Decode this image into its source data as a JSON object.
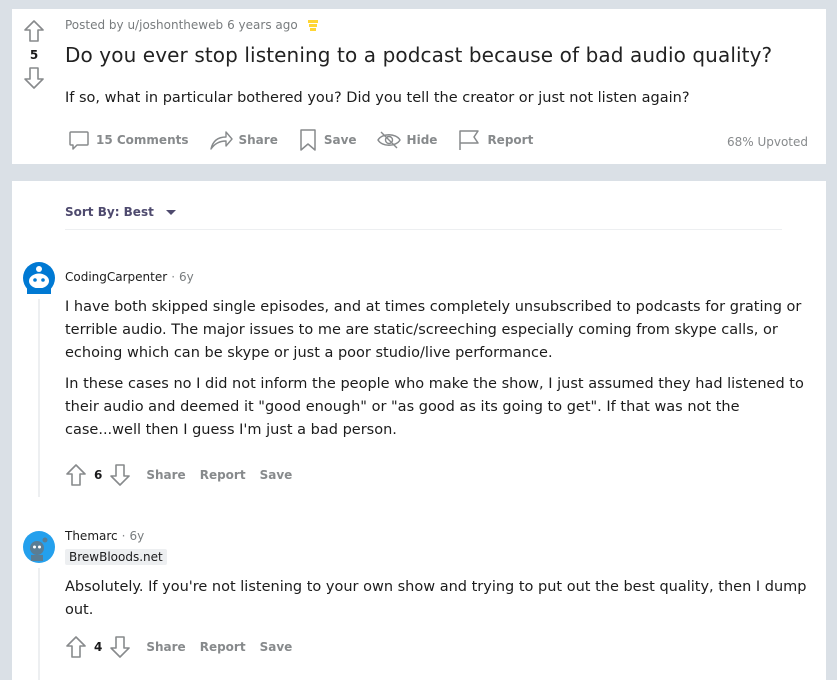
{
  "post": {
    "score": "5",
    "posted_by": "Posted by u/joshontheweb",
    "age": "6 years ago",
    "title": "Do you ever stop listening to a podcast because of bad audio quality?",
    "body": "If so, what in particular bothered you? Did you tell the creator or just not listen again?",
    "actions": {
      "comments": "15 Comments",
      "share": "Share",
      "save": "Save",
      "hide": "Hide",
      "report": "Report"
    },
    "upvoted": "68% Upvoted"
  },
  "sort": {
    "label": "Sort By: Best"
  },
  "comments": [
    {
      "author": "CodingCarpenter",
      "dot": "·",
      "age": "6y",
      "paragraphs": [
        "I have both skipped single episodes, and at times completely unsubscribed to podcasts for grating or terrible audio. The major issues to me are static/screeching especially coming from skype calls, or echoing which can be skype or just a poor studio/live performance.",
        "In these cases no I did not inform the people who make the show, I just assumed they had listened to their audio and deemed it \"good enough\" or \"as good as its going to get\". If that was not the case...well then I guess I'm just a bad person."
      ],
      "score": "6",
      "share": "Share",
      "report": "Report",
      "save": "Save"
    },
    {
      "author": "Themarc",
      "dot": "·",
      "age": "6y",
      "flair": "BrewBloods.net",
      "paragraphs": [
        "Absolutely. If you're not listening to your own show and trying to put out the best quality, then I dump out."
      ],
      "score": "4",
      "share": "Share",
      "report": "Report",
      "save": "Save"
    }
  ],
  "colors": {
    "background": "#dae0e6",
    "card": "#ffffff",
    "muted": "#878a8c",
    "sort_accent": "#4e4a6e",
    "award": "#ffd635",
    "avatar_blue": "#0079d3",
    "avatar_teal": "#24a0ed"
  }
}
